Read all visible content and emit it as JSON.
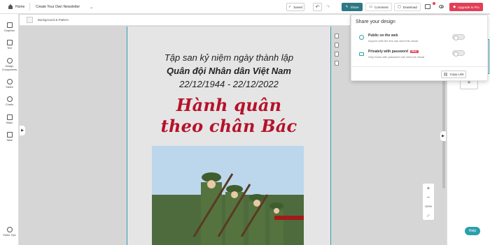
{
  "topbar": {
    "home_label": "Home",
    "doc_title": "Create Your Own Newsletter",
    "saved_label": "Saved",
    "share_label": "Share",
    "comment_label": "Comment",
    "download_label": "Download",
    "upgrade_label": "Upgrade to Pro",
    "accent_color": "#2c7985",
    "upgrade_color": "#e23f57"
  },
  "sidebar": {
    "items": [
      {
        "label": "Graphics",
        "icon": "graphics-icon"
      },
      {
        "label": "Text",
        "icon": "text-icon"
      },
      {
        "label": "Design Components",
        "icon": "design-components-icon"
      },
      {
        "label": "Slides",
        "icon": "slides-icon"
      },
      {
        "label": "Charts",
        "icon": "charts-icon"
      },
      {
        "label": "Maps",
        "icon": "maps-icon"
      },
      {
        "label": "Table",
        "icon": "table-icon"
      }
    ],
    "tips_label": "Editor Tips"
  },
  "subbar": {
    "background_label": "Background & Pattern"
  },
  "page": {
    "line1": "Tập san kỷ niệm ngày thành lập",
    "line2": "Quân đội Nhân dân Việt Nam",
    "line3": "22/12/1944 - 22/12/2022",
    "headline1": "Hành quân",
    "headline2": "theo chân Bác",
    "headline_color": "#b5122b"
  },
  "zoom": {
    "plus": "+",
    "minus": "−",
    "value": "100%"
  },
  "share": {
    "title": "Share your design",
    "public_label": "Public on the web",
    "public_desc": "Anyone with the link can view this visual",
    "private_label": "Privately with password",
    "private_badge": "PRO",
    "private_desc": "Only those with password can view the visual",
    "copy_label": "Copy Link"
  },
  "help_label": "Help"
}
